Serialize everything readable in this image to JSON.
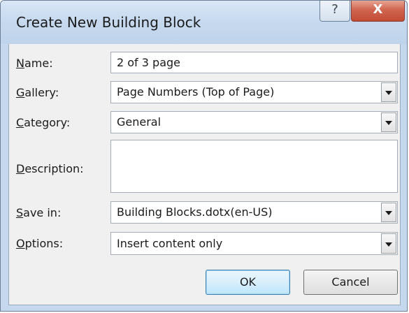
{
  "window": {
    "title": "Create New Building Block",
    "help_glyph": "?",
    "close_glyph": "X"
  },
  "form": {
    "name": {
      "label_u": "N",
      "label_rest": "ame:",
      "value": "2 of 3 page"
    },
    "gallery": {
      "label_u": "G",
      "label_rest": "allery:",
      "value": "Page Numbers (Top of Page)"
    },
    "category": {
      "label_u": "C",
      "label_rest": "ategory:",
      "value": "General"
    },
    "description": {
      "label_u": "D",
      "label_rest": "escription:",
      "value": ""
    },
    "save_in": {
      "label_u": "S",
      "label_rest": "ave in:",
      "value": "Building Blocks.dotx(en-US)"
    },
    "options": {
      "label_u": "O",
      "label_rest": "ptions:",
      "value": "Insert content only"
    }
  },
  "buttons": {
    "ok": "OK",
    "cancel": "Cancel"
  }
}
